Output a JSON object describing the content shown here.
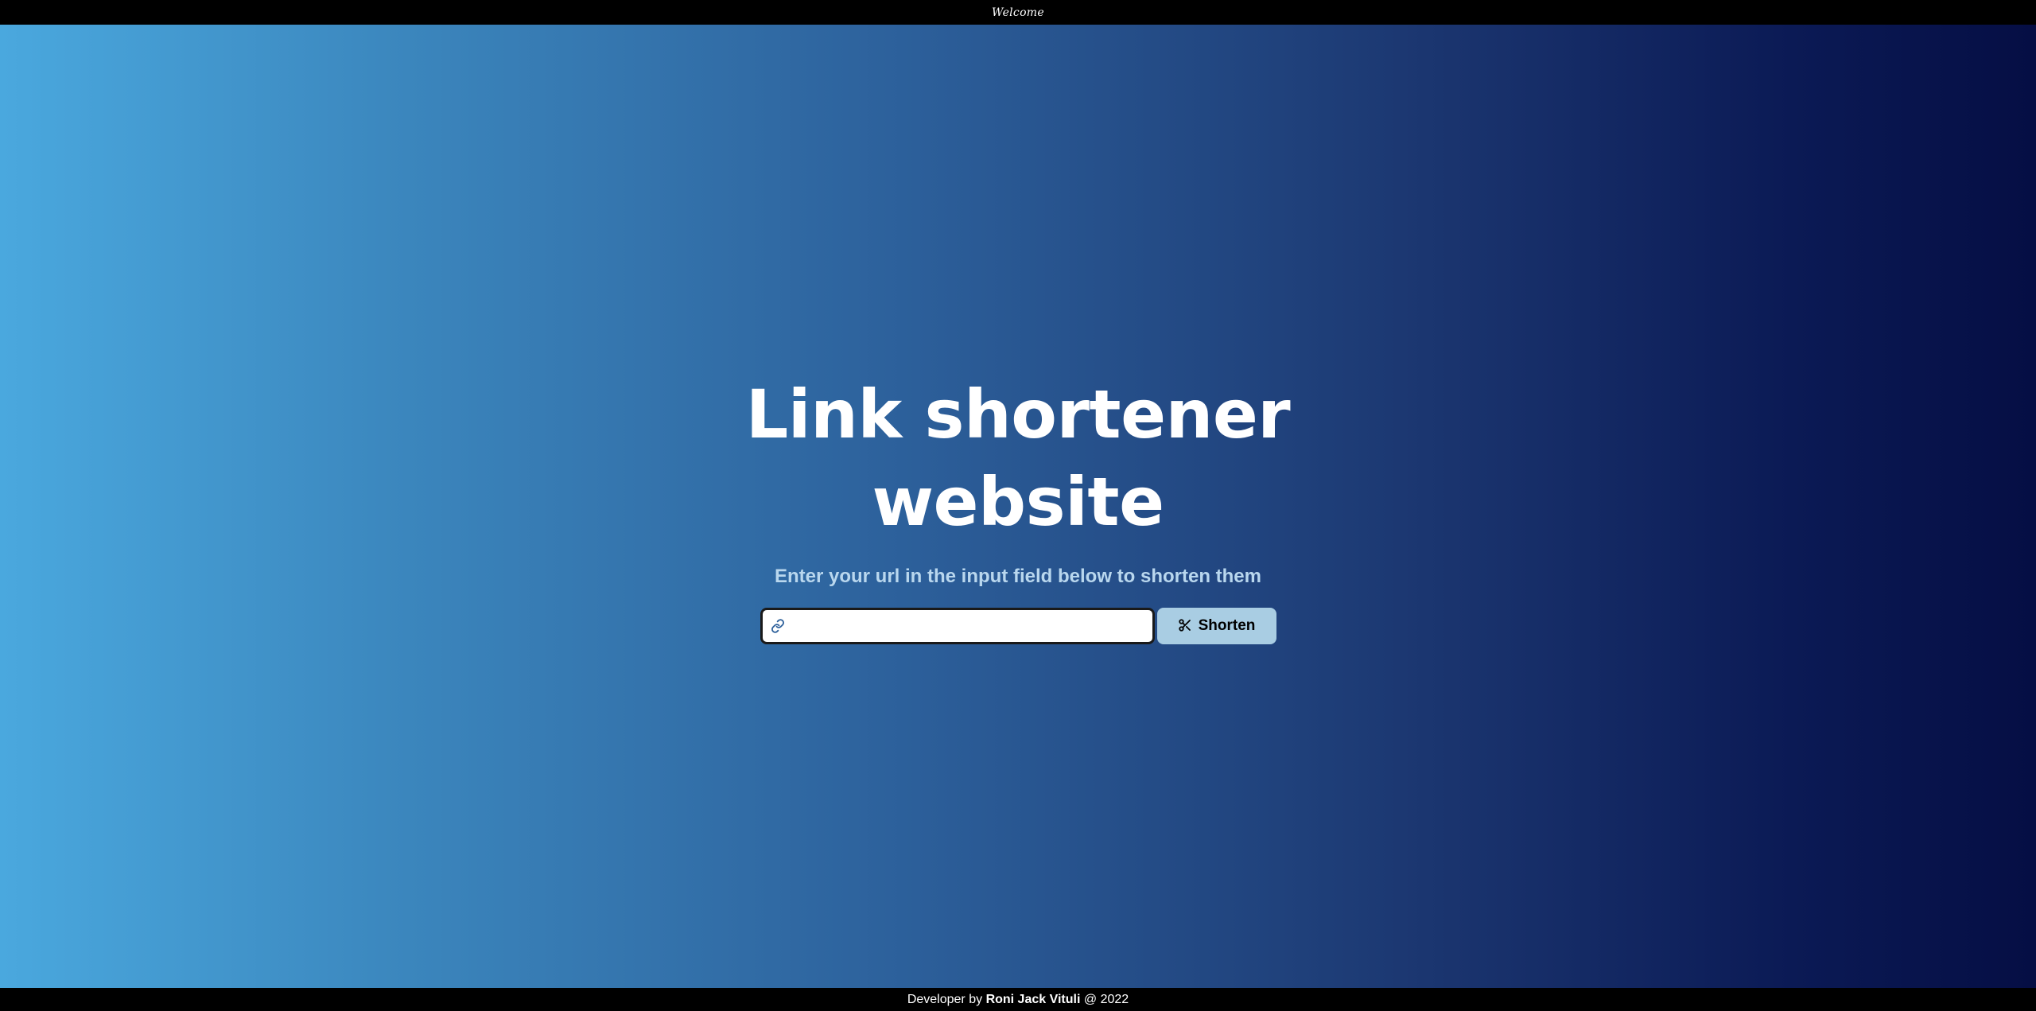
{
  "header": {
    "title": "Welcome"
  },
  "hero": {
    "headline_line1": "Link shortener",
    "headline_line2": "website",
    "subtitle": "Enter your url in the input field below to shorten them",
    "input": {
      "value": "",
      "placeholder": "",
      "icon": "link-icon"
    },
    "button": {
      "label": "Shorten",
      "icon": "scissors-icon"
    }
  },
  "footer": {
    "prefix": "Developer by",
    "name": "Roni Jack Vituli",
    "suffix": "@ 2022"
  },
  "colors": {
    "gradient_start": "#4aa8de",
    "gradient_end": "#050e44",
    "button_bg": "#a9cde3",
    "subtitle": "#b9d7ee",
    "bar": "#000000"
  }
}
